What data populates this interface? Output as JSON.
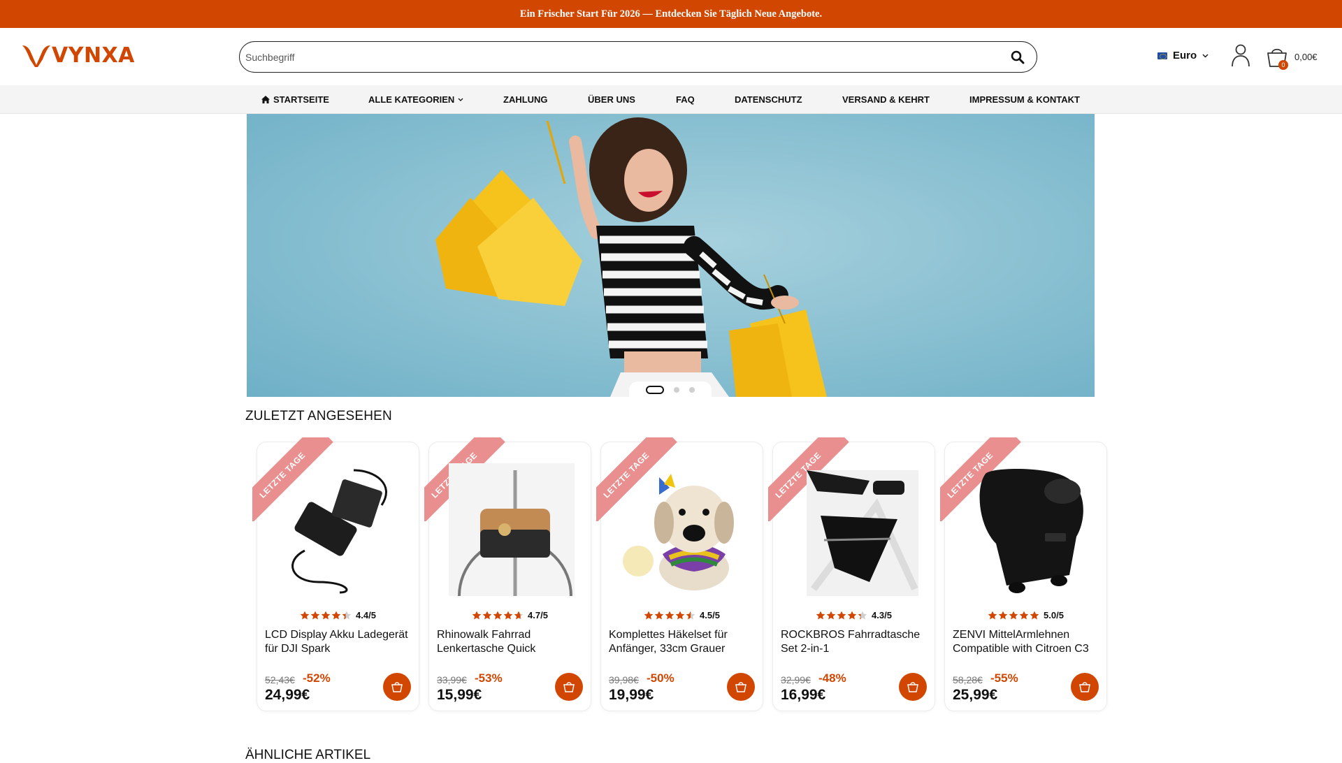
{
  "announcement": "Ein Frischer Start Für 2026 — Entdecken Sie Täglich Neue Angebote.",
  "brand": {
    "name": "VYNXA",
    "color": "#d14600"
  },
  "search": {
    "placeholder": "Suchbegriff",
    "value": ""
  },
  "currency": {
    "label": "Euro"
  },
  "cart": {
    "count": "0",
    "total": "0,00€"
  },
  "nav": {
    "items": [
      {
        "label": "STARTSEITE",
        "icon": "home-icon"
      },
      {
        "label": "ALLE KATEGORIEN",
        "icon": "chevron-down-icon"
      },
      {
        "label": "ZAHLUNG"
      },
      {
        "label": "ÜBER UNS"
      },
      {
        "label": "FAQ"
      },
      {
        "label": "DATENSCHUTZ"
      },
      {
        "label": "VERSAND & KEHRT"
      },
      {
        "label": "IMPRESSUM & KONTAKT"
      }
    ]
  },
  "carousel": {
    "slides": 3,
    "active": 1
  },
  "recent": {
    "title": "ZULETZT ANGESEHEN",
    "ribbon": "LETZTE TAGE",
    "products": [
      {
        "title": "LCD Display Akku Ladegerät für DJI Spark",
        "rating": 4.4,
        "rating_text": "4.4/5",
        "old_price": "52,43€",
        "discount": "-52%",
        "price": "24,99€"
      },
      {
        "title": "Rhinowalk Fahrrad Lenkertasche Quick",
        "rating": 4.7,
        "rating_text": "4.7/5",
        "old_price": "33,99€",
        "discount": "-53%",
        "price": "15,99€"
      },
      {
        "title": "Komplettes Häkelset für Anfänger, 33cm Grauer",
        "rating": 4.5,
        "rating_text": "4.5/5",
        "old_price": "39,98€",
        "discount": "-50%",
        "price": "19,99€"
      },
      {
        "title": "ROCKBROS Fahrradtasche Set 2-in-1",
        "rating": 4.3,
        "rating_text": "4.3/5",
        "old_price": "32,99€",
        "discount": "-48%",
        "price": "16,99€"
      },
      {
        "title": "ZENVI MittelArmlehnen Compatible with Citroen C3",
        "rating": 5.0,
        "rating_text": "5.0/5",
        "old_price": "58,28€",
        "discount": "-55%",
        "price": "25,99€"
      }
    ]
  },
  "similar": {
    "title": "ÄHNLICHE ARTIKEL"
  }
}
